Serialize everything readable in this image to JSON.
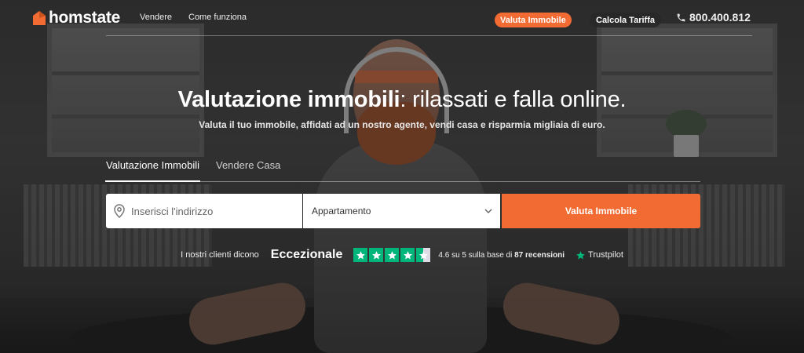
{
  "nav": {
    "brand": "homstate",
    "links": [
      {
        "label": "Vendere"
      },
      {
        "label": "Come funziona"
      }
    ],
    "cta_valuta": "Valuta Immobile",
    "cta_calcola": "Calcola Tariffa",
    "phone": "800.400.812"
  },
  "hero": {
    "title_bold": "Valutazione immobili",
    "title_rest": ": rilassati e falla online.",
    "subtitle": "Valuta il tuo immobile, affidati ad un nostro agente, vendi casa e risparmia migliaia di euro."
  },
  "tabs": [
    {
      "label": "Valutazione Immobili",
      "active": true
    },
    {
      "label": "Vendere Casa",
      "active": false
    }
  ],
  "form": {
    "address_placeholder": "Inserisci l'indirizzo",
    "address_value": "",
    "property_type_selected": "Appartamento",
    "submit_label": "Valuta Immobile"
  },
  "trust": {
    "intro": "I nostri clienti dicono",
    "rating_word": "Eccezionale",
    "stars": 4.5,
    "score_text": "4.6 su 5 sulla base di",
    "reviews_count": "87 recensioni",
    "provider": "Trustpilot"
  },
  "colors": {
    "accent": "#f26b32",
    "trustpilot_green": "#00b67a"
  },
  "icons": {
    "logo": "house-icon",
    "phone": "phone-icon",
    "address": "location-pin-icon",
    "select": "chevron-down-icon",
    "rating": "star-icon"
  }
}
